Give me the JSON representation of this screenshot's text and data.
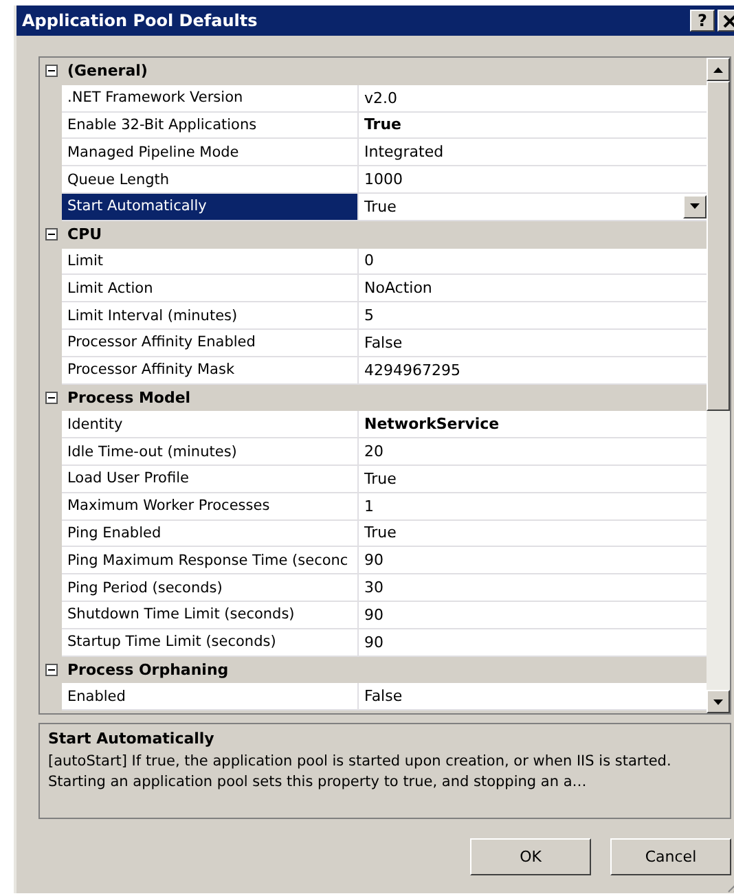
{
  "window": {
    "title": "Application Pool Defaults",
    "help_button": "?"
  },
  "property_grid": {
    "categories": [
      {
        "name": "(General)",
        "expanded": true,
        "properties": [
          {
            "name": ".NET Framework Version",
            "value": "v2.0",
            "modified": false,
            "selected": false
          },
          {
            "name": "Enable 32-Bit Applications",
            "value": "True",
            "modified": true,
            "selected": false
          },
          {
            "name": "Managed Pipeline Mode",
            "value": "Integrated",
            "modified": false,
            "selected": false
          },
          {
            "name": "Queue Length",
            "value": "1000",
            "modified": false,
            "selected": false
          },
          {
            "name": "Start Automatically",
            "value": "True",
            "modified": false,
            "selected": true
          }
        ]
      },
      {
        "name": "CPU",
        "expanded": true,
        "properties": [
          {
            "name": "Limit",
            "value": "0",
            "modified": false,
            "selected": false
          },
          {
            "name": "Limit Action",
            "value": "NoAction",
            "modified": false,
            "selected": false
          },
          {
            "name": "Limit Interval (minutes)",
            "value": "5",
            "modified": false,
            "selected": false
          },
          {
            "name": "Processor Affinity Enabled",
            "value": "False",
            "modified": false,
            "selected": false
          },
          {
            "name": "Processor Affinity Mask",
            "value": "4294967295",
            "modified": false,
            "selected": false
          }
        ]
      },
      {
        "name": "Process Model",
        "expanded": true,
        "properties": [
          {
            "name": "Identity",
            "value": "NetworkService",
            "modified": true,
            "selected": false
          },
          {
            "name": "Idle Time-out (minutes)",
            "value": "20",
            "modified": false,
            "selected": false
          },
          {
            "name": "Load User Profile",
            "value": "True",
            "modified": false,
            "selected": false
          },
          {
            "name": "Maximum Worker Processes",
            "value": "1",
            "modified": false,
            "selected": false
          },
          {
            "name": "Ping Enabled",
            "value": "True",
            "modified": false,
            "selected": false
          },
          {
            "name": "Ping Maximum Response Time (seconc",
            "value": "90",
            "modified": false,
            "selected": false
          },
          {
            "name": "Ping Period (seconds)",
            "value": "30",
            "modified": false,
            "selected": false
          },
          {
            "name": "Shutdown Time Limit (seconds)",
            "value": "90",
            "modified": false,
            "selected": false
          },
          {
            "name": "Startup Time Limit (seconds)",
            "value": "90",
            "modified": false,
            "selected": false
          }
        ]
      },
      {
        "name": "Process Orphaning",
        "expanded": true,
        "properties": [
          {
            "name": "Enabled",
            "value": "False",
            "modified": false,
            "selected": false
          }
        ]
      }
    ]
  },
  "description": {
    "title": "Start Automatically",
    "text": "[autoStart] If true, the application pool is started upon creation, or when IIS is started.  Starting an application pool sets this property to true, and stopping an a…"
  },
  "buttons": [
    "OK",
    "Cancel"
  ]
}
